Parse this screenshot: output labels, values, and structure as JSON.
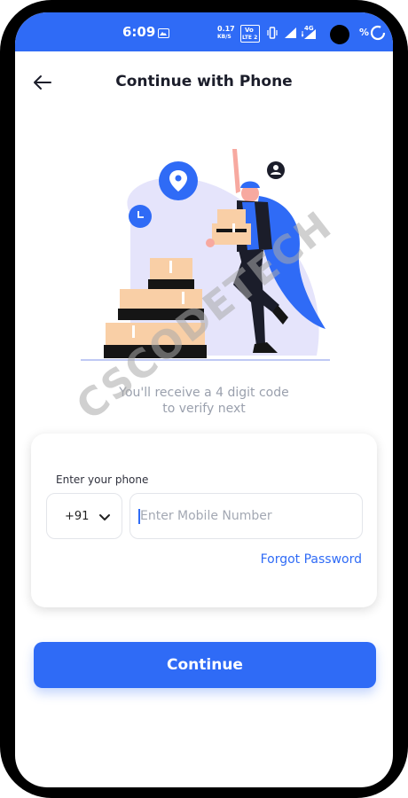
{
  "status_bar": {
    "time": "6:09",
    "speed_value": "0.17",
    "speed_unit": "KB/S",
    "volte_top": "Vo",
    "volte_bottom": "LTE 2",
    "network_label": "4G",
    "battery_percent": "%"
  },
  "header": {
    "title": "Continue with Phone"
  },
  "illustration": {
    "description_icons": [
      "location-pin-icon",
      "clock-icon",
      "user-icon"
    ]
  },
  "subtitle": {
    "line1": "You'll receive a 4 digit code",
    "line2": "to verify next"
  },
  "watermark": {
    "text": "CSCODETECH"
  },
  "form": {
    "phone_label": "Enter your phone",
    "country_code": "+91",
    "phone_placeholder": "Enter Mobile Number",
    "phone_value": "",
    "forgot_label": "Forgot Password"
  },
  "actions": {
    "continue_label": "Continue"
  },
  "colors": {
    "primary": "#2f6bf6",
    "title": "#1b1d2a",
    "subtitle": "#9aa0ad"
  }
}
